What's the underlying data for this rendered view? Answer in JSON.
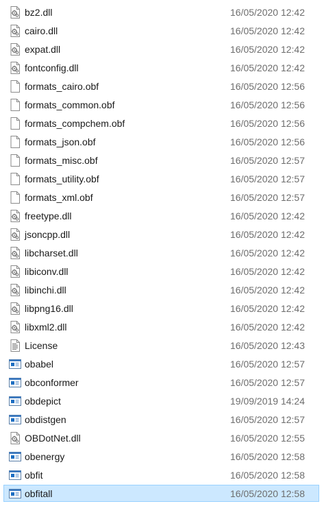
{
  "files": [
    {
      "name": "bz2.dll",
      "modified": "16/05/2020 12:42",
      "icon": "dll-file-icon",
      "selected": false
    },
    {
      "name": "cairo.dll",
      "modified": "16/05/2020 12:42",
      "icon": "dll-file-icon",
      "selected": false
    },
    {
      "name": "expat.dll",
      "modified": "16/05/2020 12:42",
      "icon": "dll-file-icon",
      "selected": false
    },
    {
      "name": "fontconfig.dll",
      "modified": "16/05/2020 12:42",
      "icon": "dll-file-icon",
      "selected": false
    },
    {
      "name": "formats_cairo.obf",
      "modified": "16/05/2020 12:56",
      "icon": "blank-file-icon",
      "selected": false
    },
    {
      "name": "formats_common.obf",
      "modified": "16/05/2020 12:56",
      "icon": "blank-file-icon",
      "selected": false
    },
    {
      "name": "formats_compchem.obf",
      "modified": "16/05/2020 12:56",
      "icon": "blank-file-icon",
      "selected": false
    },
    {
      "name": "formats_json.obf",
      "modified": "16/05/2020 12:56",
      "icon": "blank-file-icon",
      "selected": false
    },
    {
      "name": "formats_misc.obf",
      "modified": "16/05/2020 12:57",
      "icon": "blank-file-icon",
      "selected": false
    },
    {
      "name": "formats_utility.obf",
      "modified": "16/05/2020 12:57",
      "icon": "blank-file-icon",
      "selected": false
    },
    {
      "name": "formats_xml.obf",
      "modified": "16/05/2020 12:57",
      "icon": "blank-file-icon",
      "selected": false
    },
    {
      "name": "freetype.dll",
      "modified": "16/05/2020 12:42",
      "icon": "dll-file-icon",
      "selected": false
    },
    {
      "name": "jsoncpp.dll",
      "modified": "16/05/2020 12:42",
      "icon": "dll-file-icon",
      "selected": false
    },
    {
      "name": "libcharset.dll",
      "modified": "16/05/2020 12:42",
      "icon": "dll-file-icon",
      "selected": false
    },
    {
      "name": "libiconv.dll",
      "modified": "16/05/2020 12:42",
      "icon": "dll-file-icon",
      "selected": false
    },
    {
      "name": "libinchi.dll",
      "modified": "16/05/2020 12:42",
      "icon": "dll-file-icon",
      "selected": false
    },
    {
      "name": "libpng16.dll",
      "modified": "16/05/2020 12:42",
      "icon": "dll-file-icon",
      "selected": false
    },
    {
      "name": "libxml2.dll",
      "modified": "16/05/2020 12:42",
      "icon": "dll-file-icon",
      "selected": false
    },
    {
      "name": "License",
      "modified": "16/05/2020 12:43",
      "icon": "text-file-icon",
      "selected": false
    },
    {
      "name": "obabel",
      "modified": "16/05/2020 12:57",
      "icon": "application-icon",
      "selected": false
    },
    {
      "name": "obconformer",
      "modified": "16/05/2020 12:57",
      "icon": "application-icon",
      "selected": false
    },
    {
      "name": "obdepict",
      "modified": "19/09/2019 14:24",
      "icon": "application-icon",
      "selected": false
    },
    {
      "name": "obdistgen",
      "modified": "16/05/2020 12:57",
      "icon": "application-icon",
      "selected": false
    },
    {
      "name": "OBDotNet.dll",
      "modified": "16/05/2020 12:55",
      "icon": "dll-file-icon",
      "selected": false
    },
    {
      "name": "obenergy",
      "modified": "16/05/2020 12:58",
      "icon": "application-icon",
      "selected": false
    },
    {
      "name": "obfit",
      "modified": "16/05/2020 12:58",
      "icon": "application-icon",
      "selected": false
    },
    {
      "name": "obfitall",
      "modified": "16/05/2020 12:58",
      "icon": "application-icon",
      "selected": true
    }
  ],
  "colors": {
    "selection_fill": "#cce8ff",
    "selection_border": "#99d1ff",
    "date_text": "#6d6d6d",
    "app_icon_blue": "#1e6fc2"
  }
}
